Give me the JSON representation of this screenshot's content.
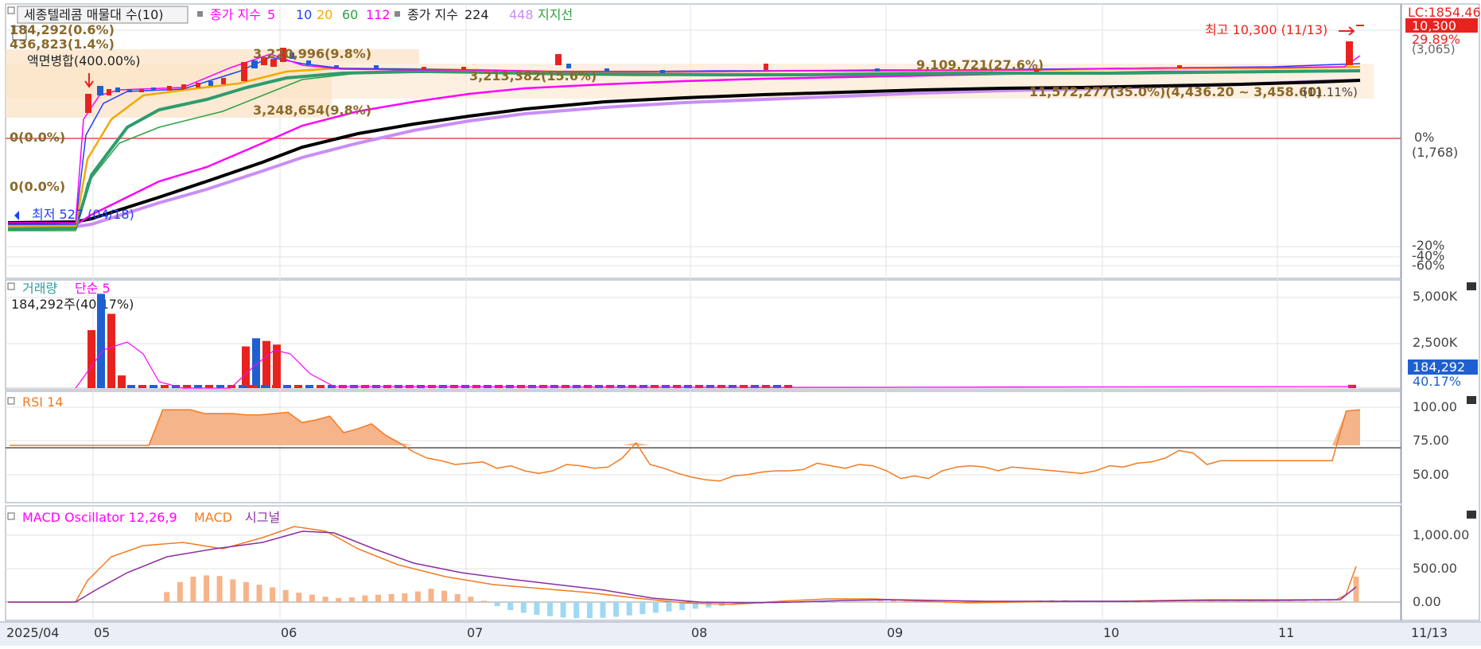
{
  "price_legend": {
    "title": "세종텔레콤 매물대 수(10)",
    "ma_label": "종가 지수",
    "ma_periods": [
      "5",
      "10",
      "20",
      "60",
      "112"
    ],
    "ma_colors": [
      "#ff00ff",
      "#1f3fff",
      "#f2a900",
      "#2ea043",
      "#ff00ff"
    ],
    "ma2_label": "종가 지수",
    "ma2_periods": [
      "224",
      "448"
    ],
    "support_label": "지지선"
  },
  "price_annotations": {
    "top_left_1": "184,292(0.6%)",
    "top_left_2": "436,823(1.4%)",
    "split_note": "액면병합(400.00%)",
    "zero_label_1": "0(0.0%)",
    "zero_label_2": "0(0.0%)",
    "volume_band_1": "3,220,996(9.8%)",
    "volume_band_2": "3,213,382(15.6%)",
    "volume_band_3": "3,248,654(9.8%)",
    "volume_band_4": "9,109,721(27.6%)",
    "volume_band_5": "11,572,277(35.0%)(4,436.20 ~ 3,458.60)",
    "high_label": "최고 10,300 (11/13)",
    "low_label": "최저 527 (04/18)",
    "support_pct": "(11.11%)"
  },
  "price_axis": {
    "top_label": "LC:1854.46",
    "current_price": "10,300",
    "current_pct": "29.89%",
    "sub_label": "(3,065)",
    "ticks": [
      "0%",
      "(1,768)",
      "-20%",
      "-40%",
      "-60%"
    ]
  },
  "volume_panel": {
    "label": "거래량",
    "ma_label": "단순 5",
    "current": "184,292주(40.17%)",
    "ticks": [
      "5,000K",
      "2,500K"
    ],
    "current_value": "184,292",
    "current_pct": "40.17%"
  },
  "rsi_panel": {
    "label": "RSI 14",
    "ticks": [
      "100.00",
      "75.00",
      "50.00"
    ]
  },
  "macd_panel": {
    "label_osc": "MACD Oscillator 12,26,9",
    "label_macd": "MACD",
    "label_signal": "시그널",
    "ticks": [
      "1,000.00",
      "500.00",
      "0.00"
    ]
  },
  "x_axis": {
    "labels": [
      "2025/04",
      "05",
      "06",
      "07",
      "08",
      "09",
      "10",
      "11"
    ],
    "last_label": "11/13"
  },
  "chart_data": [
    {
      "type": "line",
      "title": "",
      "series": [
        {
          "name": "종가 지수 5",
          "values": []
        },
        {
          "name": "종가 지수 224",
          "values": []
        }
      ],
      "high": 10300,
      "low": 527,
      "ylim_pct": [
        -60,
        29.89
      ]
    },
    {
      "type": "bar",
      "name": "거래량",
      "x": [
        "05",
        "05",
        "05",
        "05",
        "06",
        "06",
        "06",
        "06",
        "11/13"
      ],
      "values": [
        3200000,
        5200000,
        4100000,
        700000,
        2300000,
        2750000,
        2600000,
        2400000,
        184292
      ],
      "ylim": [
        0,
        5000000
      ]
    },
    {
      "type": "line",
      "name": "RSI 14",
      "ylim": [
        25,
        100
      ],
      "reference": 70,
      "values": [
        70,
        70,
        70,
        70,
        70,
        70,
        70,
        70,
        70,
        70,
        70,
        98,
        98,
        98,
        95,
        95,
        95,
        94,
        94,
        95,
        96,
        88,
        90,
        93,
        80,
        83,
        87,
        78,
        72,
        65,
        60,
        58,
        55,
        56,
        57,
        52,
        54,
        50,
        48,
        50,
        55,
        54,
        52,
        53,
        60,
        72,
        55,
        52,
        48,
        45,
        43,
        42,
        46,
        47,
        49,
        50,
        50,
        51,
        56,
        54,
        52,
        55,
        54,
        50,
        44,
        46,
        44,
        50,
        53,
        54,
        53,
        50,
        53,
        52,
        51,
        50,
        49,
        48,
        50,
        54,
        53,
        56,
        57,
        60,
        66,
        64,
        55,
        58,
        58,
        58,
        58,
        58,
        58,
        58,
        58,
        58,
        97,
        98
      ]
    },
    {
      "type": "bar",
      "name": "MACD Oscillator 12,26,9",
      "ylim": [
        -300,
        1400
      ],
      "values": [
        0,
        0,
        0,
        0,
        0,
        0,
        150,
        300,
        380,
        400,
        390,
        340,
        300,
        260,
        220,
        180,
        140,
        110,
        80,
        60,
        70,
        100,
        110,
        120,
        130,
        160,
        200,
        170,
        120,
        80,
        20,
        -60,
        -120,
        -160,
        -190,
        -210,
        -230,
        -240,
        -240,
        -235,
        -220,
        -200,
        -180,
        -160,
        -140,
        -120,
        -100,
        -80,
        -60,
        -40,
        -30,
        -25,
        -20,
        -15,
        -10,
        -8,
        -5,
        -3,
        0,
        10,
        20,
        30,
        25,
        20,
        15,
        10,
        5,
        0,
        0,
        10,
        15,
        20,
        25,
        30,
        30,
        25,
        20,
        15,
        15,
        15,
        15,
        15,
        15,
        15,
        15,
        15,
        15,
        15,
        15,
        15,
        15,
        15,
        15,
        15,
        15,
        15,
        380
      ]
    }
  ],
  "colors": {
    "up": "#e8231f",
    "down": "#1f5fd1",
    "rsi": "#f47a20",
    "rsi_fill": "#f6b48a",
    "macd": "#f47a20",
    "signal": "#8a2ea0",
    "osc_pos": "#f6b48a",
    "osc_neg": "#9fd8f2",
    "band": "#fbe3c7",
    "grid": "#d9d9d9",
    "axis_bg": "#e9eef7"
  }
}
